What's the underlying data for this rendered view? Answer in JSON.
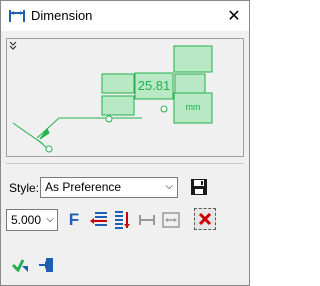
{
  "window": {
    "title": "Dimension",
    "close_glyph": "✕"
  },
  "preview": {
    "value_text": "25.81",
    "unit_text": "mm",
    "accent": "#22b14c"
  },
  "style": {
    "label": "Style:",
    "selected": "As Preference"
  },
  "toolbar": {
    "size_value": "5.000",
    "font_glyph": "F"
  },
  "colors": {
    "green": "#22b14c",
    "blue": "#1f5fb3",
    "red": "#cc0000"
  },
  "icons": [
    "dimension-icon",
    "close-icon",
    "expand-icon",
    "save-icon",
    "font-icon",
    "align-left-icon",
    "align-vertical-icon",
    "dimension-horizontal-icon",
    "dimension-stretch-icon",
    "delete-icon",
    "ok-icon",
    "apply-icon"
  ]
}
